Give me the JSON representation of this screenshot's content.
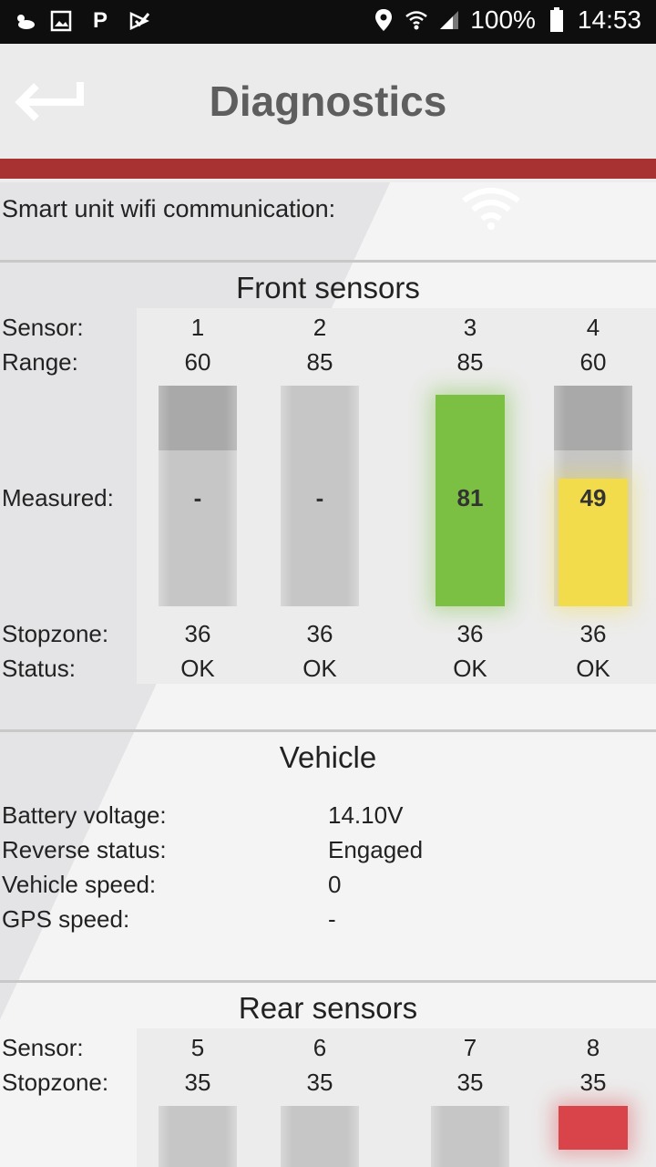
{
  "status_bar": {
    "icons_left": [
      "weather-icon",
      "image-icon",
      "pw-icon",
      "check-icon"
    ],
    "pw_text": "P",
    "location_icon": "location-icon",
    "battery_percent": "100%",
    "time": "14:53"
  },
  "appbar": {
    "back_icon": "back-arrow-icon",
    "title": "Diagnostics",
    "accent_color": "#a83232"
  },
  "wifi": {
    "label": "Smart unit wifi communication:",
    "icon": "wifi-icon"
  },
  "front": {
    "title": "Front sensors",
    "labels": {
      "sensor": "Sensor:",
      "range": "Range:",
      "measured": "Measured:",
      "stopzone": "Stopzone:",
      "status": "Status:"
    },
    "sensors": [
      {
        "id": "1",
        "range": "60",
        "measured": "-",
        "stopzone": "36",
        "status": "OK"
      },
      {
        "id": "2",
        "range": "85",
        "measured": "-",
        "stopzone": "36",
        "status": "OK"
      },
      {
        "id": "3",
        "range": "85",
        "measured": "81",
        "stopzone": "36",
        "status": "OK",
        "color": "#7bc043"
      },
      {
        "id": "4",
        "range": "60",
        "measured": "49",
        "stopzone": "36",
        "status": "OK",
        "color": "#f2dc4b"
      }
    ]
  },
  "vehicle": {
    "title": "Vehicle",
    "rows": [
      {
        "label": "Battery voltage:",
        "value": "14.10V"
      },
      {
        "label": "Reverse status:",
        "value": "Engaged"
      },
      {
        "label": "Vehicle speed:",
        "value": "0"
      },
      {
        "label": "GPS speed:",
        "value": "-"
      }
    ]
  },
  "rear": {
    "title": "Rear sensors",
    "labels": {
      "sensor": "Sensor:",
      "stopzone": "Stopzone:"
    },
    "sensors": [
      {
        "id": "5",
        "stopzone": "35"
      },
      {
        "id": "6",
        "stopzone": "35"
      },
      {
        "id": "7",
        "stopzone": "35"
      },
      {
        "id": "8",
        "stopzone": "35",
        "color": "#d9434a"
      }
    ]
  }
}
